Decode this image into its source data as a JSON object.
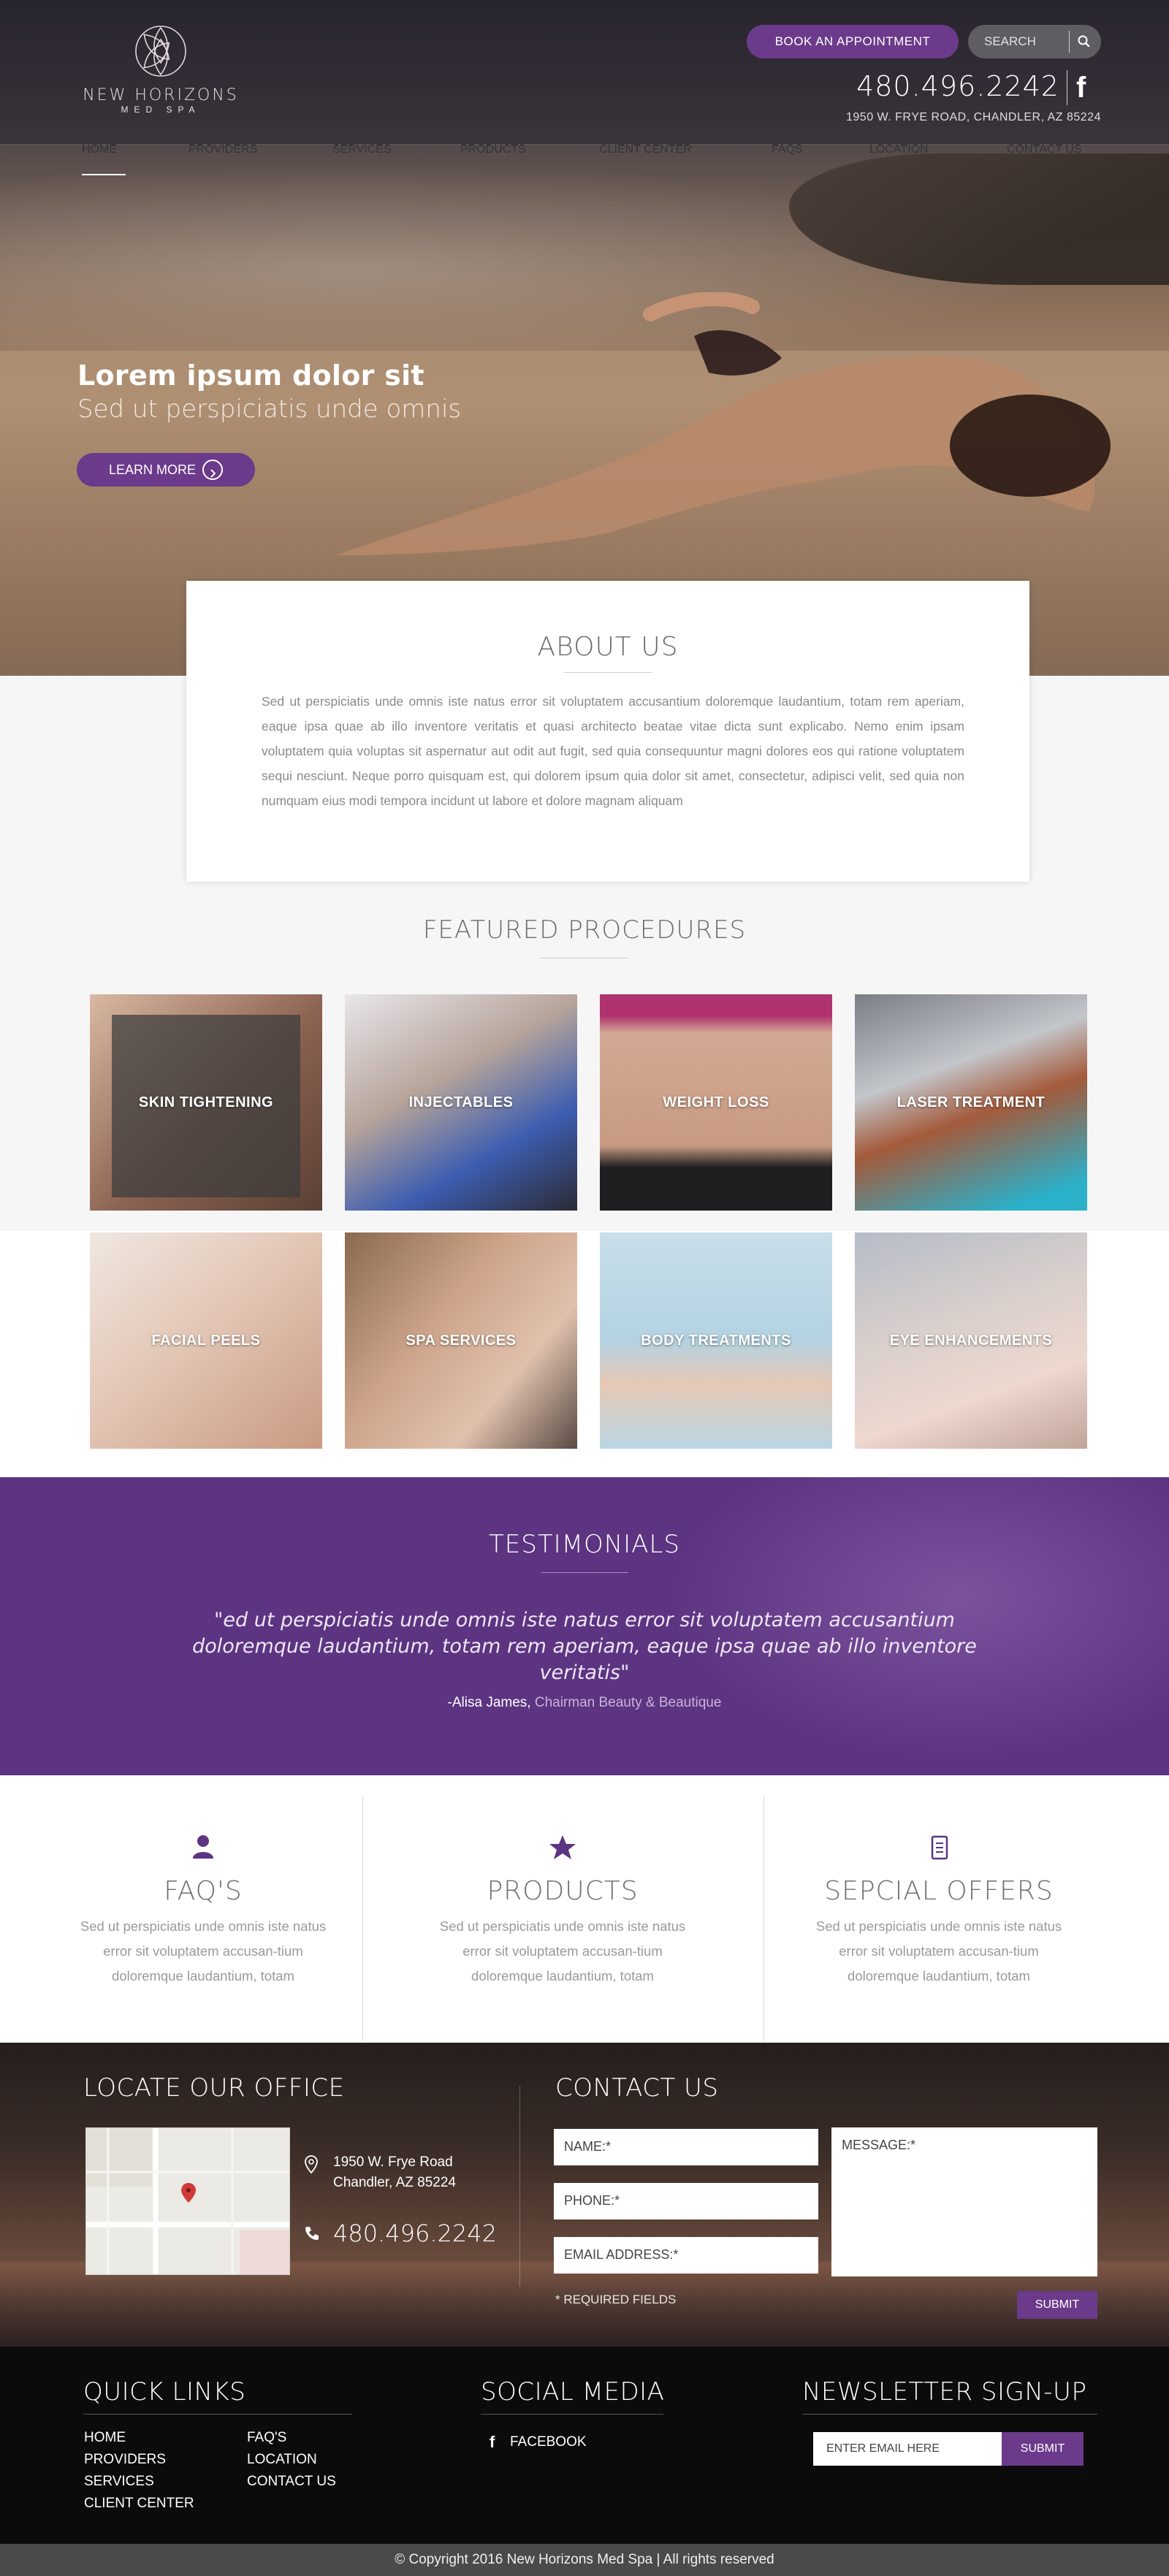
{
  "logo": {
    "line1": "NEW HORIZONS",
    "line2": "MED SPA"
  },
  "header": {
    "book_label": "BOOK AN APPOINTMENT",
    "search_placeholder": "SEARCH",
    "phone": "480.496.2242",
    "address": "1950 W. FRYE ROAD, CHANDLER, AZ 85224",
    "facebook_icon": "facebook-icon"
  },
  "nav": {
    "items": [
      {
        "label": "HOME"
      },
      {
        "label": "PROVIDERS"
      },
      {
        "label": "SERVICES"
      },
      {
        "label": "PRODUCTS"
      },
      {
        "label": "CLIENT CENTER"
      },
      {
        "label": "FAQS"
      },
      {
        "label": "LOCATION"
      },
      {
        "label": "CONTACT US"
      }
    ],
    "active": "HOME"
  },
  "hero": {
    "title": "Lorem ipsum dolor sit",
    "subtitle": "Sed ut perspiciatis unde omnis",
    "button": "LEARN MORE"
  },
  "about": {
    "title": "ABOUT US",
    "text": "Sed ut perspiciatis unde omnis iste natus error sit voluptatem accusantium doloremque laudantium, totam rem aperiam, eaque ipsa quae ab illo inventore veritatis et quasi architecto beatae vitae dicta sunt explicabo. Nemo enim ipsam voluptatem quia voluptas sit aspernatur aut odit aut fugit, sed quia consequuntur magni dolores eos qui ratione voluptatem sequi nesciunt. Neque porro quisquam est, qui dolorem ipsum quia dolor sit amet, consectetur, adipisci velit, sed quia non numquam eius modi tempora incidunt ut labore et dolore magnam aliquam"
  },
  "featured": {
    "title": "FEATURED PROCEDURES",
    "items": [
      {
        "label": "SKIN TIGHTENING"
      },
      {
        "label": "INJECTABLES"
      },
      {
        "label": "WEIGHT LOSS"
      },
      {
        "label": "LASER TREATMENT"
      },
      {
        "label": "FACIAL PEELS"
      },
      {
        "label": "SPA SERVICES"
      },
      {
        "label": "BODY TREATMENTS"
      },
      {
        "label": "EYE ENHANCEMENTS"
      }
    ]
  },
  "testimonials": {
    "title": "TESTIMONIALS",
    "quote": "\"ed ut perspiciatis unde omnis iste natus error sit voluptatem accusantium doloremque laudantium, totam rem aperiam, eaque ipsa quae ab illo inventore veritatis\"",
    "author": "-Alisa James,",
    "org": "Chairman Beauty & Beautique"
  },
  "info": [
    {
      "title": "FAQ'S",
      "icon": "user-icon",
      "text": "Sed ut perspiciatis unde omnis iste natus error sit voluptatem accusan-tium doloremque laudantium, totam"
    },
    {
      "title": "PRODUCTS",
      "icon": "star-icon",
      "text": "Sed ut perspiciatis unde omnis iste natus error sit voluptatem accusan-tium doloremque laudantium, totam"
    },
    {
      "title": "SEPCIAL OFFERS",
      "icon": "document-icon",
      "text": "Sed ut perspiciatis unde omnis iste natus error sit voluptatem accusan-tium doloremque laudantium, totam"
    }
  ],
  "office": {
    "title": "LOCATE OUR OFFICE",
    "address_line1": "1950 W. Frye Road",
    "address_line2": "Chandler, AZ 85224",
    "phone": "480.496.2242"
  },
  "contact": {
    "title": "CONTACT US",
    "name_placeholder": "NAME:*",
    "phone_placeholder": "PHONE:*",
    "email_placeholder": "EMAIL ADDRESS:*",
    "message_placeholder": "MESSAGE:*",
    "required_note": "* REQUIRED FIELDS",
    "submit": "SUBMIT"
  },
  "footer": {
    "quick_links_title": "QUICK LINKS",
    "quick_links_col1": [
      "HOME",
      "PROVIDERS",
      "SERVICES",
      "CLIENT CENTER"
    ],
    "quick_links_col2": [
      "FAQ'S",
      "LOCATION",
      "CONTACT US"
    ],
    "social_title": "SOCIAL MEDIA",
    "social_link": "FACEBOOK",
    "newsletter_title": "NEWSLETTER SIGN-UP",
    "newsletter_placeholder": "ENTER EMAIL HERE",
    "newsletter_button": "SUBMIT",
    "copyright": "© Copyright 2016 New Horizons Med Spa  | All rights reserved"
  },
  "colors": {
    "accent_purple": "#6b3a8a",
    "testimonial_bg": "#5c3481",
    "footer_bg": "#0b0b0b",
    "copyright_bg": "#4a4a4a"
  }
}
